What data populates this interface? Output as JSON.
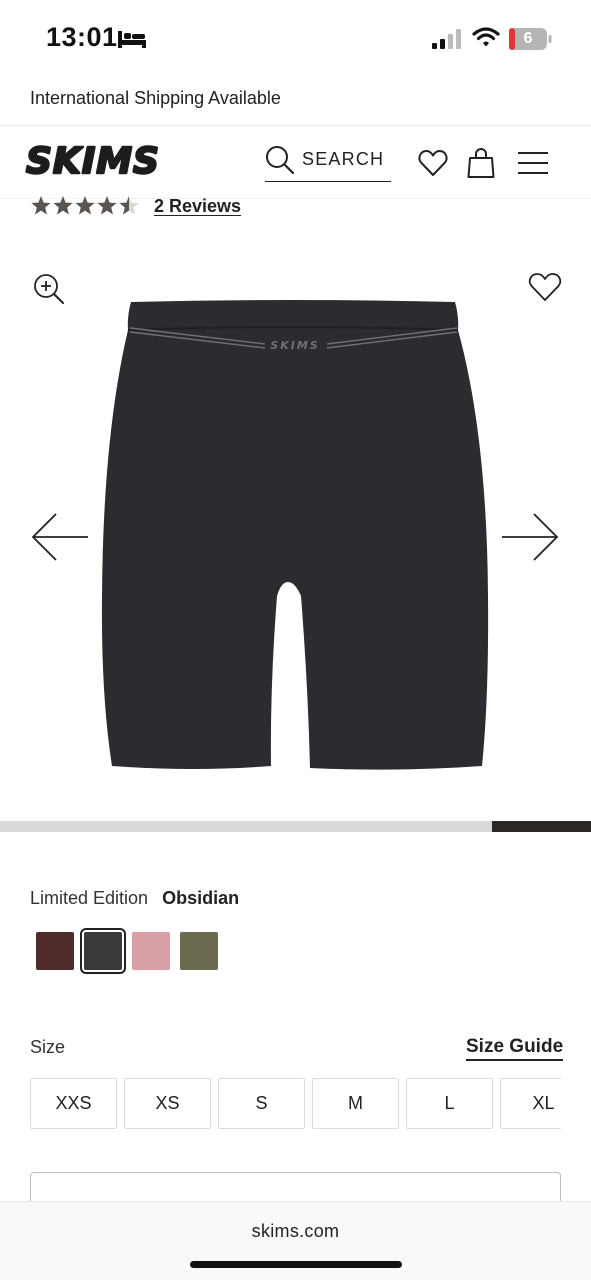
{
  "status_bar": {
    "time": "13:01",
    "battery_level": "6"
  },
  "promo": {
    "text": "International Shipping Available"
  },
  "header": {
    "logo": "SKIMS",
    "search_label": "SEARCH"
  },
  "rating": {
    "stars": 4.5,
    "reviews_label": "2 Reviews"
  },
  "gallery": {
    "image_wordmark": "SKIMS",
    "progress_fraction": 0.167
  },
  "color": {
    "label": "Limited Edition",
    "selected": "Obsidian",
    "swatches": [
      {
        "name": "burgundy",
        "hex": "#4f2b2a"
      },
      {
        "name": "Obsidian",
        "hex": "#3a3a3c",
        "selected": true
      },
      {
        "name": "rose",
        "hex": "#d6a0a6"
      },
      {
        "name": "olive",
        "hex": "#6b6a4f"
      }
    ]
  },
  "size": {
    "label": "Size",
    "guide_label": "Size Guide",
    "options": [
      "XXS",
      "XS",
      "S",
      "M",
      "L",
      "XL"
    ]
  },
  "browser": {
    "url": "skims.com"
  },
  "colors": {
    "text": "#222222",
    "progress_track": "#d9d9d9",
    "progress_fill": "#2a2724",
    "garment": "#2b2c30"
  }
}
